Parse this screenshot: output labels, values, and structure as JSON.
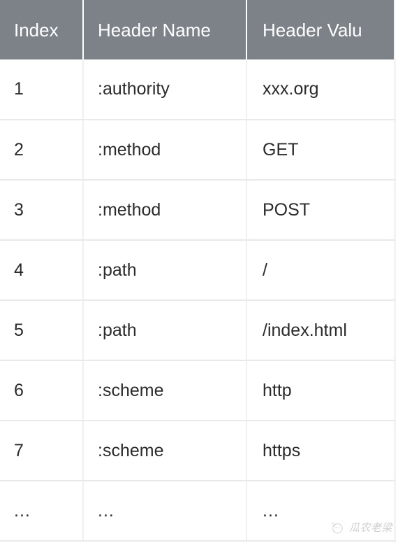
{
  "table": {
    "columns": [
      {
        "key": "index",
        "label": "Index"
      },
      {
        "key": "name",
        "label": "Header Name"
      },
      {
        "key": "value",
        "label": "Header Valu"
      }
    ],
    "rows": [
      {
        "index": "1",
        "name": ":authority",
        "value": "xxx.org"
      },
      {
        "index": "2",
        "name": ":method",
        "value": "GET"
      },
      {
        "index": "3",
        "name": ":method",
        "value": "POST"
      },
      {
        "index": "4",
        "name": ":path",
        "value": "/"
      },
      {
        "index": "5",
        "name": ":path",
        "value": "/index.html"
      },
      {
        "index": "6",
        "name": ":scheme",
        "value": "http"
      },
      {
        "index": "7",
        "name": ":scheme",
        "value": "https"
      },
      {
        "index": "...",
        "name": "...",
        "value": "..."
      }
    ]
  },
  "watermark": {
    "text": "瓜农老梁",
    "logo_icon": "circle-logo-icon"
  },
  "colors": {
    "header_background": "#7c8288",
    "header_text": "#ffffff",
    "cell_background": "#ffffff",
    "cell_text": "#2b2b2b",
    "row_divider": "#e9e9e9",
    "column_divider": "#f0f0f0"
  }
}
